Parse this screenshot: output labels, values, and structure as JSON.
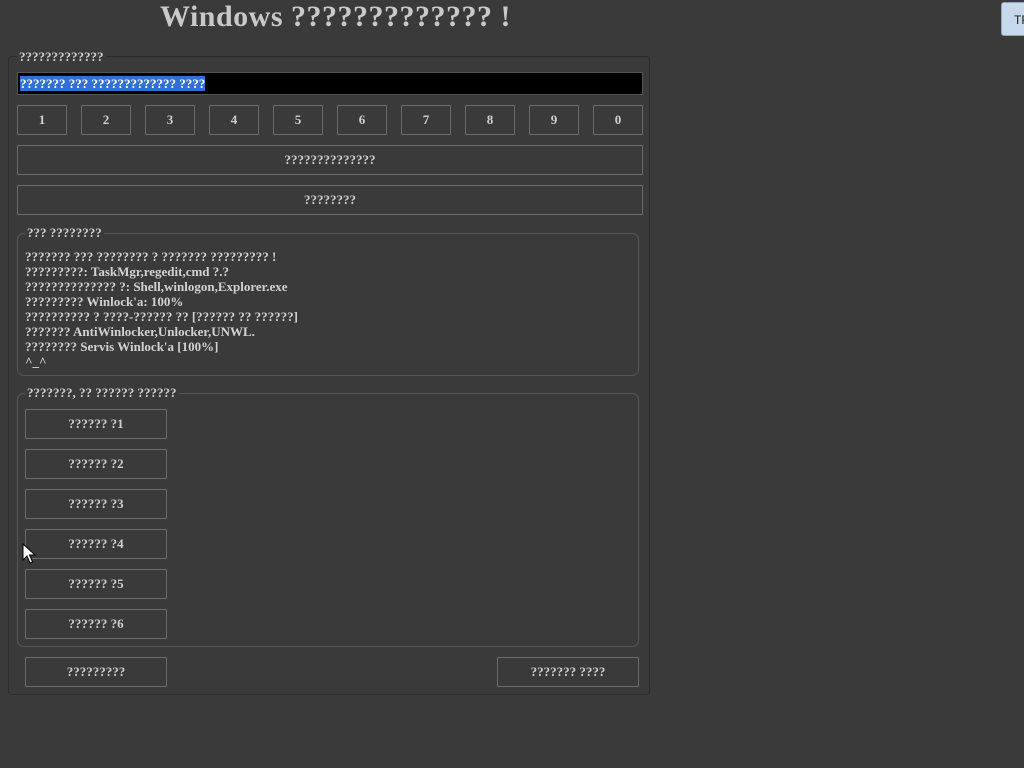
{
  "title": "Windows ????????????? !",
  "corner_tab": "TF",
  "code_section": {
    "legend": "?????????????",
    "input_value": "??????? ??? ????????????? ????"
  },
  "keypad": [
    "1",
    "2",
    "3",
    "4",
    "5",
    "6",
    "7",
    "8",
    "9",
    "0"
  ],
  "actions": {
    "primary_label": "??????????????",
    "secondary_label": "????????"
  },
  "info": {
    "legend": "??? ????????",
    "lines": [
      "??????? ??? ???????? ? ??????? ????????? !",
      "?????????: TaskMgr,regedit,cmd ?.?",
      "?????????????? ?: Shell,winlogon,Explorer.exe",
      "????????? Winlock'a: 100%",
      "?????????? ? ????-?????? ?? [?????? ?? ??????]",
      "??????? AntiWinlocker,Unlocker,UNWL.",
      "???????? Servis Winlock'a [100%]",
      "^_^"
    ]
  },
  "options": {
    "legend": "???????, ?? ?????? ??????",
    "items": [
      "?????? ?1",
      "?????? ?2",
      "?????? ?3",
      "?????? ?4",
      "?????? ?5",
      "?????? ?6"
    ]
  },
  "footer": {
    "left_label": "?????????",
    "right_label": "??????? ????"
  }
}
